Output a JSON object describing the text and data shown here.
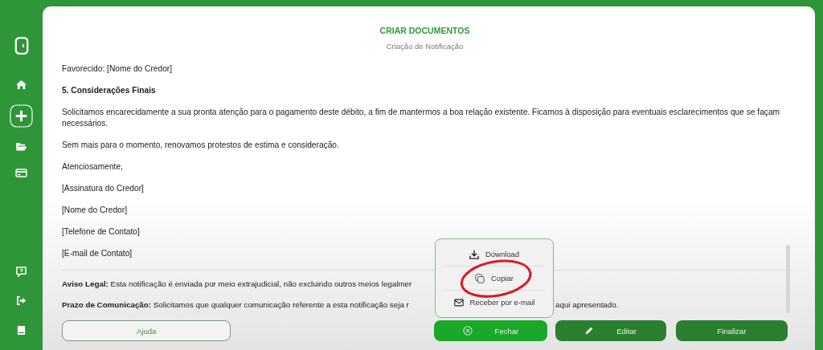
{
  "header": {
    "title": "CRIAR DOCUMENTOS",
    "subtitle": "Criação de Notificação"
  },
  "paragraphs": [
    {
      "kind": "text",
      "text": "Favorecido: [Nome do Credor]"
    },
    {
      "kind": "heading",
      "text": "5. Considerações Finais"
    },
    {
      "kind": "text",
      "text": "Solicitamos encarecidamente a sua pronta atenção para o pagamento deste débito, a fim de mantermos a boa relação existente. Ficamos à disposição para eventuais esclarecimentos que se façam necessários."
    },
    {
      "kind": "text",
      "text": "Sem mais para o momento, renovamos protestos de estima e consideração."
    },
    {
      "kind": "text",
      "text": "Atenciosamente,"
    },
    {
      "kind": "text",
      "text": "[Assinatura do Credor]"
    },
    {
      "kind": "text",
      "text": "[Nome do Credor]"
    },
    {
      "kind": "text",
      "text": "[Telefone de Contato]"
    },
    {
      "kind": "text",
      "text": "[E-mail de Contato]"
    }
  ],
  "legal": [
    {
      "text": "**Aviso Legal:** Esta notificação é enviada por meio extrajudicial, não excluindo outros meios legalmer"
    },
    {
      "text": "**Prazo de Comunicação:** Solicitamos que qualquer comunicação referente a esta notificação seja r",
      "text_after": "aqui apresentado."
    }
  ],
  "menu": [
    {
      "kind": "download",
      "label": "Download"
    },
    {
      "kind": "copy",
      "label": "Copiar"
    },
    {
      "kind": "email",
      "label": "Receber por e-mail"
    }
  ],
  "buttons": [
    {
      "kind": "help",
      "label": "Ajuda"
    },
    {
      "kind": "close",
      "label": "Fechar"
    },
    {
      "kind": "edit",
      "label": "Editar"
    },
    {
      "kind": "finish",
      "label": "Finalizar"
    }
  ]
}
